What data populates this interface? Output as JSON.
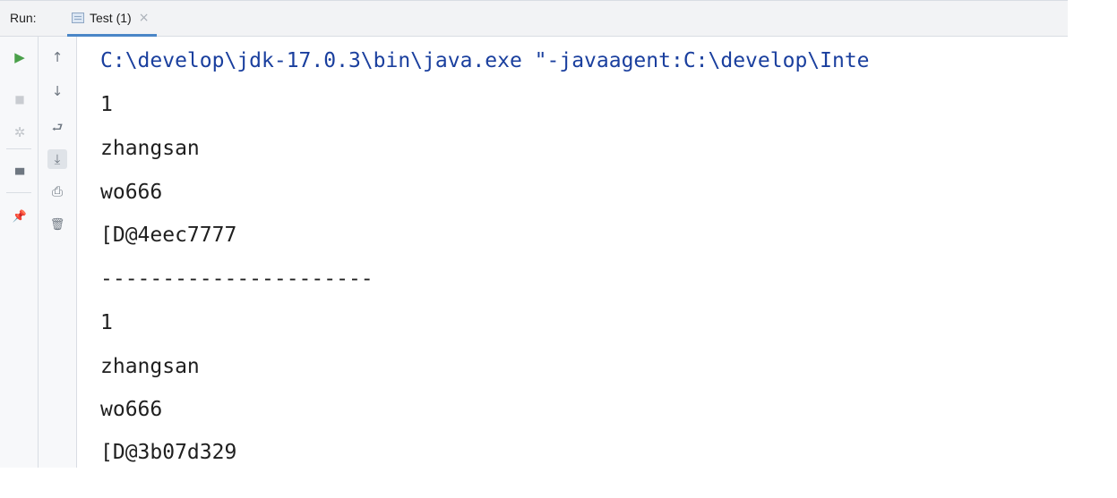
{
  "run_panel": {
    "title": "Run:",
    "tab": {
      "label": "Test (1)",
      "close_glyph": "×",
      "icon": "console-tab-icon"
    },
    "toolbar_left": [
      {
        "name": "rerun-icon",
        "glyph": "▶",
        "color": "#4aa04a"
      },
      {
        "name": "stop-icon",
        "glyph": "■",
        "color": "#c9ccd1"
      },
      {
        "name": "debug-icon",
        "glyph": "✲",
        "color": "#c3c7cc"
      },
      {
        "name": "layout-icon",
        "glyph": "▀",
        "color": "#6e7781"
      },
      {
        "name": "pin-icon",
        "glyph": "📌",
        "color": "#6e7781"
      }
    ],
    "toolbar_right": [
      {
        "name": "scroll-up-icon",
        "glyph": "↑"
      },
      {
        "name": "scroll-down-icon",
        "glyph": "↓"
      },
      {
        "name": "soft-wrap-icon",
        "glyph": "⮐"
      },
      {
        "name": "scroll-to-end-icon",
        "glyph": "⤓"
      },
      {
        "name": "print-icon",
        "glyph": "⎙"
      },
      {
        "name": "clear-all-icon",
        "glyph": "🗑"
      }
    ]
  },
  "console": {
    "command_color": "#1a3f9e",
    "lines": [
      "C:\\develop\\jdk-17.0.3\\bin\\java.exe \"-javaagent:C:\\develop\\Inte",
      "1",
      "zhangsan",
      "wo666",
      "[D@4eec7777",
      "----------------------",
      "1",
      "zhangsan",
      "wo666",
      "[D@3b07d329"
    ]
  }
}
